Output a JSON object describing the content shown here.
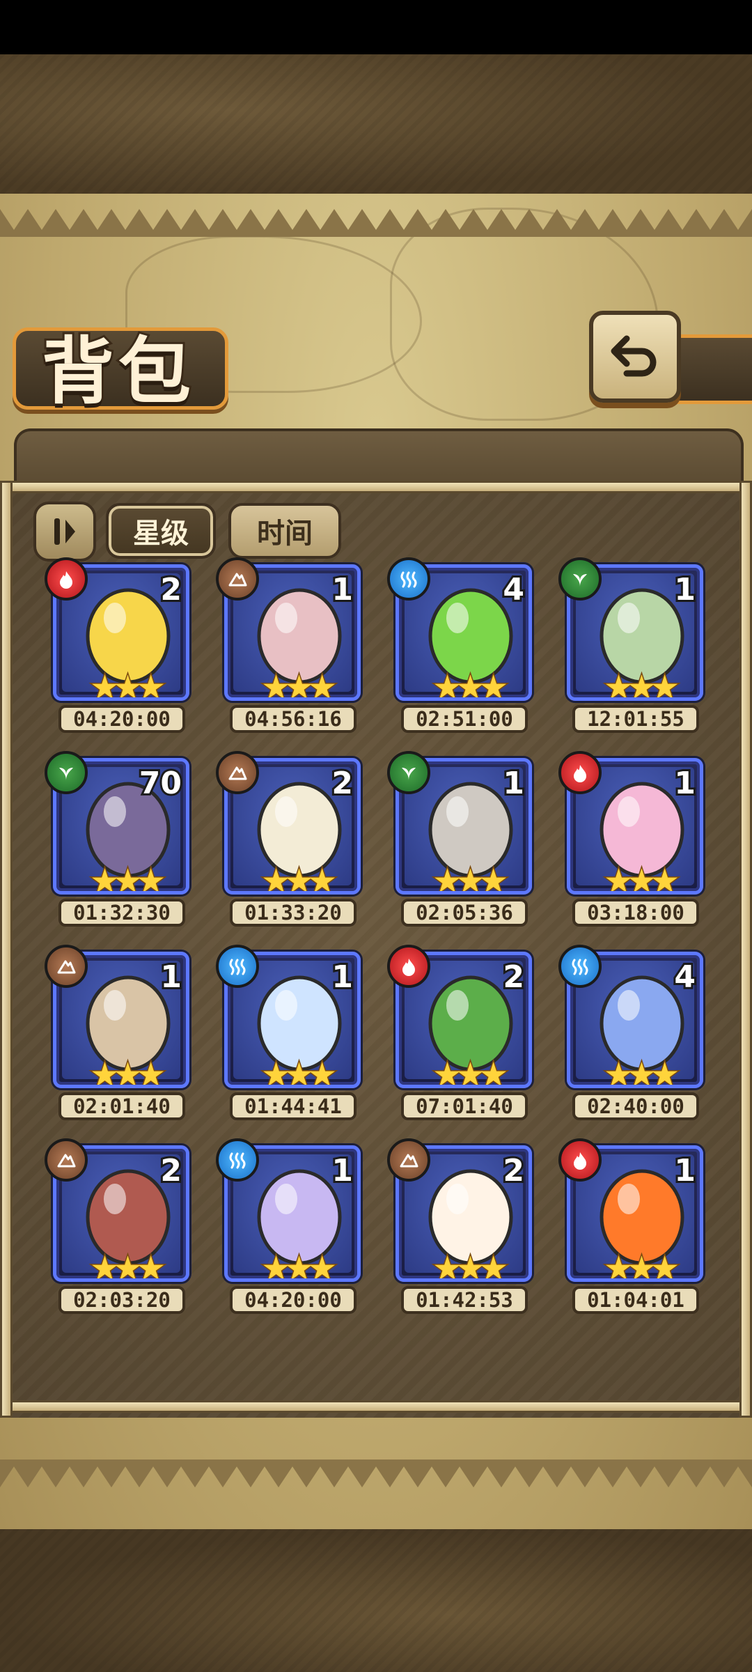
{
  "header": {
    "title": "背包"
  },
  "filters": {
    "star_tab": "星级",
    "time_tab": "时间"
  },
  "eggs": [
    {
      "element": "fire",
      "count": "2",
      "time": "04:20:00",
      "art": "sun-egg-icon",
      "color": "#f7d64a"
    },
    {
      "element": "earth",
      "count": "1",
      "time": "04:56:16",
      "art": "bow-egg-icon",
      "color": "#e8c0c4"
    },
    {
      "element": "water",
      "count": "4",
      "time": "02:51:00",
      "art": "slime-egg-icon",
      "color": "#7cd64a"
    },
    {
      "element": "grass",
      "count": "1",
      "time": "12:01:55",
      "art": "leaf-egg-icon",
      "color": "#b8d6a6"
    },
    {
      "element": "grass",
      "count": "70",
      "time": "01:32:30",
      "art": "striped-egg-icon",
      "color": "#7a6a9a"
    },
    {
      "element": "earth",
      "count": "2",
      "time": "01:33:20",
      "art": "fluffy-horn-egg-icon",
      "color": "#f3ecd6"
    },
    {
      "element": "grass",
      "count": "1",
      "time": "02:05:36",
      "art": "helmet-egg-icon",
      "color": "#cfc9c2"
    },
    {
      "element": "fire",
      "count": "1",
      "time": "03:18:00",
      "art": "pink-jelly-egg-icon",
      "color": "#f5b8d6"
    },
    {
      "element": "earth",
      "count": "1",
      "time": "02:01:40",
      "art": "hairy-egg-icon",
      "color": "#d9c4a6"
    },
    {
      "element": "water",
      "count": "1",
      "time": "01:44:41",
      "art": "cloud-egg-icon",
      "color": "#cfe4ff"
    },
    {
      "element": "fire",
      "count": "2",
      "time": "07:01:40",
      "art": "cactus-egg-icon",
      "color": "#5cae4a"
    },
    {
      "element": "water",
      "count": "4",
      "time": "02:40:00",
      "art": "crystal-egg-icon",
      "color": "#8aa8f0"
    },
    {
      "element": "earth",
      "count": "2",
      "time": "02:03:20",
      "art": "cat-hood-egg-icon",
      "color": "#b05a50"
    },
    {
      "element": "water",
      "count": "1",
      "time": "04:20:00",
      "art": "jellyfish-egg-icon",
      "color": "#c8b8f2"
    },
    {
      "element": "earth",
      "count": "2",
      "time": "01:42:53",
      "art": "puff-egg-icon",
      "color": "#fff3e6"
    },
    {
      "element": "fire",
      "count": "1",
      "time": "01:04:01",
      "art": "flame-egg-icon",
      "color": "#ff7a2a"
    }
  ],
  "stars_text": "★★★"
}
